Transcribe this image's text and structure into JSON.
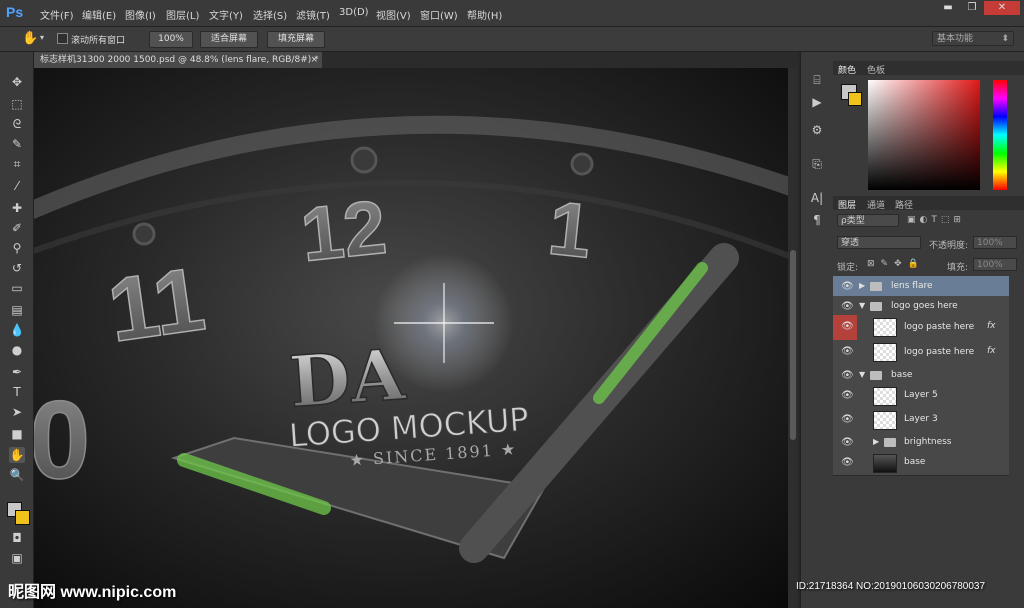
{
  "app": {
    "logo": "Ps"
  },
  "menu": [
    "文件(F)",
    "编辑(E)",
    "图像(I)",
    "图层(L)",
    "文字(Y)",
    "选择(S)",
    "滤镜(T)",
    "3D(D)",
    "视图(V)",
    "窗口(W)",
    "帮助(H)"
  ],
  "window_controls": {
    "minimize": "▬",
    "restore": "❐",
    "close": "✕"
  },
  "options": {
    "scroll_all_label": "滚动所有窗口",
    "zoom_100": "100%",
    "fit_screen": "适合屏幕",
    "fill_screen": "填充屏幕",
    "workspace": "基本功能"
  },
  "document": {
    "tab_title": "标志样机31300 2000 1500.psd @ 48.8% (lens flare, RGB/8#) *",
    "close": "×"
  },
  "canvas_text": {
    "n12": "12",
    "n11": "11",
    "n1": "1",
    "n0": "0",
    "logo": "DA",
    "tagline": "LOGO MOCKUP",
    "since": "★ SINCE 1891 ★"
  },
  "color_panel": {
    "tab_color": "颜色",
    "tab_swatches": "色板",
    "foreground": "#c8c8c8",
    "background": "#f0c21c"
  },
  "layers_panel": {
    "tabs": [
      "图层",
      "通道",
      "路径"
    ],
    "kind_filter": "ρ类型",
    "blend_mode": "穿透",
    "opacity_label": "不透明度:",
    "opacity_value": "100%",
    "lock_label": "锁定:",
    "fill_label": "填充:",
    "fill_value": "100%"
  },
  "layers": [
    {
      "name": "lens flare",
      "type": "folder",
      "selected": true
    },
    {
      "name": "logo goes here",
      "type": "folder"
    },
    {
      "name": "logo paste here",
      "type": "smart",
      "fx": "fx"
    },
    {
      "name": "logo paste here",
      "type": "smart",
      "fx": "fx"
    },
    {
      "name": "base",
      "type": "folder"
    },
    {
      "name": "Layer 5",
      "type": "layer"
    },
    {
      "name": "Layer 3",
      "type": "layer"
    },
    {
      "name": "brightness",
      "type": "folder"
    },
    {
      "name": "base",
      "type": "layer"
    }
  ],
  "watermark": {
    "left": "昵图网 www.nipic.com",
    "right": "ID:21718364 NO:20190106030206780037"
  },
  "colors": {
    "accent": "#4fa3ff",
    "selected_layer": "#6a7d96",
    "hands_green": "#6fc84a"
  }
}
